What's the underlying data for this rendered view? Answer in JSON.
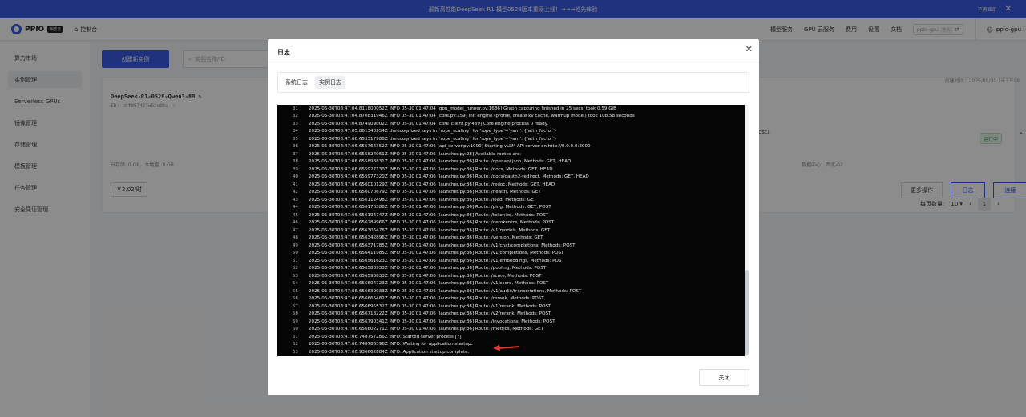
{
  "banner": {
    "text": "最新高性能DeepSeek R1 模型0528版本重磅上线！→→→抢先体验",
    "dismiss_label": "不再显示"
  },
  "header": {
    "logo_text": "PPIO",
    "logo_badge": "派欧云",
    "console_label": "控制台",
    "nav": [
      "模型服务",
      "GPU 云服务",
      "费用",
      "设置",
      "文档"
    ],
    "user_chip_name": "ppio-gpu",
    "user_chip_tag": "个人",
    "user_name": "ppio-gpu"
  },
  "sidebar": {
    "items": [
      {
        "label": "算力市场"
      },
      {
        "label": "实例管理"
      },
      {
        "label": "Serverless GPUs"
      },
      {
        "label": "镜像管理"
      },
      {
        "label": "存储管理"
      },
      {
        "label": "模板管理"
      },
      {
        "label": "任务管理"
      },
      {
        "label": "安全凭证管理"
      }
    ]
  },
  "main": {
    "create_button": "创建新实例",
    "search_placeholder": "实例名称/ID",
    "card": {
      "created": "创建时间：2025/05/30 16:37:08",
      "name": "DeepSeek-R1-0528-Qwen3-8B",
      "id": "ID: c0f957427e53e9ba",
      "disk": "云存储: 0 GB，本地盘: 0 GB",
      "price": "￥2.02/时",
      "ost_text": "ost1",
      "status": "运行中",
      "region": "数据中心：西北-02",
      "more_button": "更多操作",
      "log_button": "日志",
      "connect_button": "连接"
    },
    "pager": {
      "page_size_label": "每页数量:",
      "page_size": "10",
      "current_page": "1"
    }
  },
  "modal": {
    "title": "日志",
    "tabs": [
      "系统日志",
      "实例日志"
    ],
    "close_button": "关闭",
    "log_lines": [
      {
        "n": "31",
        "t": "2025-05-30T08:47:04.811800052Z INFO 05-30 01:47:04 [gpu_model_runner.py:1686] Graph capturing finished in 25 secs, took 0.59 GiB"
      },
      {
        "n": "32",
        "t": "2025-05-30T08:47:04.870831946Z INFO 05-30 01:47:04 [core.py:159] init engine (profile, create kv cache, warmup model) took 108.58 seconds"
      },
      {
        "n": "33",
        "t": "2025-05-30T08:47:04.874909002Z INFO 05-30 01:47:04 [core_client.py:439] Core engine process 0 ready."
      },
      {
        "n": "34",
        "t": "2025-05-30T08:47:05.861348954Z Unrecognized keys in `rope_scaling` for 'rope_type'='yarn': {'attn_factor'}"
      },
      {
        "n": "35",
        "t": "2025-05-30T08:47:06.653317988Z Unrecognized keys in `rope_scaling` for 'rope_type'='yarn': {'attn_factor'}"
      },
      {
        "n": "36",
        "t": "2025-05-30T08:47:06.655764352Z INFO 05-30 01:47:06 [api_server.py:1090] Starting vLLM API server on http://0.0.0.0:8000"
      },
      {
        "n": "37",
        "t": "2025-05-30T08:47:06.655824961Z INFO 05-30 01:47:06 [launcher.py:28] Available routes are:"
      },
      {
        "n": "38",
        "t": "2025-05-30T08:47:06.655893831Z INFO 05-30 01:47:06 [launcher.py:36] Route: /openapi.json, Methods: GET, HEAD"
      },
      {
        "n": "39",
        "t": "2025-05-30T08:47:06.655927130Z INFO 05-30 01:47:06 [launcher.py:36] Route: /docs, Methods: GET, HEAD"
      },
      {
        "n": "40",
        "t": "2025-05-30T08:47:06.655977320Z INFO 05-30 01:47:06 [launcher.py:36] Route: /docs/oauth2-redirect, Methods: GET, HEAD"
      },
      {
        "n": "41",
        "t": "2025-05-30T08:47:06.656010129Z INFO 05-30 01:47:06 [launcher.py:36] Route: /redoc, Methods: GET, HEAD"
      },
      {
        "n": "42",
        "t": "2025-05-30T08:47:06.656070679Z INFO 05-30 01:47:06 [launcher.py:36] Route: /health, Methods: GET"
      },
      {
        "n": "43",
        "t": "2025-05-30T08:47:06.656112498Z INFO 05-30 01:47:06 [launcher.py:36] Route: /load, Methods: GET"
      },
      {
        "n": "44",
        "t": "2025-05-30T08:47:06.656170388Z INFO 05-30 01:47:06 [launcher.py:36] Route: /ping, Methods: GET, POST"
      },
      {
        "n": "45",
        "t": "2025-05-30T08:47:06.656194747Z INFO 05-30 01:47:06 [launcher.py:36] Route: /tokenize, Methods: POST"
      },
      {
        "n": "46",
        "t": "2025-05-30T08:47:06.656289966Z INFO 05-30 01:47:06 [launcher.py:36] Route: /detokenize, Methods: POST"
      },
      {
        "n": "47",
        "t": "2025-05-30T08:47:06.656306476Z INFO 05-30 01:47:06 [launcher.py:36] Route: /v1/models, Methods: GET"
      },
      {
        "n": "48",
        "t": "2025-05-30T08:47:06.656342896Z INFO 05-30 01:47:06 [launcher.py:36] Route: /version, Methods: GET"
      },
      {
        "n": "49",
        "t": "2025-05-30T08:47:06.656371785Z INFO 05-30 01:47:06 [launcher.py:36] Route: /v1/chat/completions, Methods: POST"
      },
      {
        "n": "50",
        "t": "2025-05-30T08:47:06.656411985Z INFO 05-30 01:47:06 [launcher.py:36] Route: /v1/completions, Methods: POST"
      },
      {
        "n": "51",
        "t": "2025-05-30T08:47:06.656561623Z INFO 05-30 01:47:06 [launcher.py:36] Route: /v1/embeddings, Methods: POST"
      },
      {
        "n": "52",
        "t": "2025-05-30T08:47:06.656583933Z INFO 05-30 01:47:06 [launcher.py:36] Route: /pooling, Methods: POST"
      },
      {
        "n": "53",
        "t": "2025-05-30T08:47:06.656593633Z INFO 05-30 01:47:06 [launcher.py:36] Route: /score, Methods: POST"
      },
      {
        "n": "54",
        "t": "2025-05-30T08:47:06.656604723Z INFO 05-30 01:47:06 [launcher.py:36] Route: /v1/score, Methods: POST"
      },
      {
        "n": "55",
        "t": "2025-05-30T08:47:06.656639033Z INFO 05-30 01:47:06 [launcher.py:36] Route: /v1/audio/transcriptions, Methods: POST"
      },
      {
        "n": "56",
        "t": "2025-05-30T08:47:06.656665482Z INFO 05-30 01:47:06 [launcher.py:36] Route: /rerank, Methods: POST"
      },
      {
        "n": "57",
        "t": "2025-05-30T08:47:06.656695532Z INFO 05-30 01:47:06 [launcher.py:36] Route: /v1/rerank, Methods: POST"
      },
      {
        "n": "58",
        "t": "2025-05-30T08:47:06.656713222Z INFO 05-30 01:47:06 [launcher.py:36] Route: /v2/rerank, Methods: POST"
      },
      {
        "n": "59",
        "t": "2025-05-30T08:47:06.656790341Z INFO 05-30 01:47:06 [launcher.py:36] Route: /invocations, Methods: POST"
      },
      {
        "n": "60",
        "t": "2025-05-30T08:47:06.656802271Z INFO 05-30 01:47:06 [launcher.py:36] Route: /metrics, Methods: GET"
      },
      {
        "n": "61",
        "t": "2025-05-30T08:47:06.748757286Z INFO: Started server process [7]"
      },
      {
        "n": "62",
        "t": "2025-05-30T08:47:06.748786396Z INFO: Waiting for application startup."
      },
      {
        "n": "63",
        "t": "2025-05-30T08:47:06.936662884Z INFO: Application startup complete."
      }
    ]
  },
  "colors": {
    "brand": "#3b5be6",
    "annotation_arrow": "#e53935",
    "status_ok": "#2e9a4b"
  }
}
